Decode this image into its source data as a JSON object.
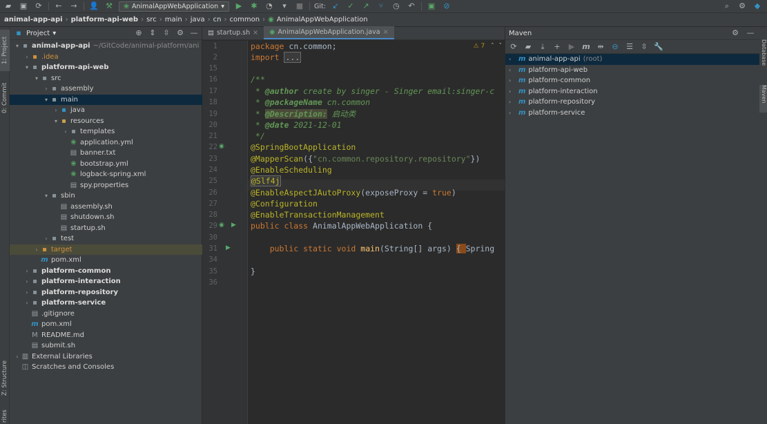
{
  "toolbar": {
    "run_config": "AnimalAppWebApplication",
    "git_label": "Git:"
  },
  "breadcrumb": [
    "animal-app-api",
    "platform-api-web",
    "src",
    "main",
    "java",
    "cn",
    "common",
    "AnimalAppWebApplication"
  ],
  "left_strip": {
    "project_tab": "1: Project",
    "commit_tab": "0: Commit",
    "structure_tab": "Z: Structure",
    "favorites_tab": "rites"
  },
  "project": {
    "title": "Project",
    "tree": [
      {
        "indent": 0,
        "arrow": "▾",
        "icon": "folder",
        "label": "animal-app-api",
        "extra": "~/GitCode/animal-platform/ani",
        "style": "bold"
      },
      {
        "indent": 1,
        "arrow": "›",
        "icon": "folder-idea",
        "label": ".idea",
        "style": "orange"
      },
      {
        "indent": 1,
        "arrow": "▾",
        "icon": "folder",
        "label": "platform-api-web",
        "style": "bold"
      },
      {
        "indent": 2,
        "arrow": "▾",
        "icon": "folder",
        "label": "src"
      },
      {
        "indent": 3,
        "arrow": "›",
        "icon": "folder",
        "label": "assembly"
      },
      {
        "indent": 3,
        "arrow": "▾",
        "icon": "folder",
        "label": "main",
        "selected": true
      },
      {
        "indent": 4,
        "arrow": "›",
        "icon": "folder-src",
        "label": "java"
      },
      {
        "indent": 4,
        "arrow": "▾",
        "icon": "folder-res",
        "label": "resources"
      },
      {
        "indent": 5,
        "arrow": "›",
        "icon": "folder",
        "label": "templates"
      },
      {
        "indent": 5,
        "arrow": "",
        "icon": "spring-file",
        "label": "application.yml"
      },
      {
        "indent": 5,
        "arrow": "",
        "icon": "text-file",
        "label": "banner.txt"
      },
      {
        "indent": 5,
        "arrow": "",
        "icon": "spring-file",
        "label": "bootstrap.yml"
      },
      {
        "indent": 5,
        "arrow": "",
        "icon": "xml-file",
        "label": "logback-spring.xml"
      },
      {
        "indent": 5,
        "arrow": "",
        "icon": "props-file",
        "label": "spy.properties"
      },
      {
        "indent": 3,
        "arrow": "▾",
        "icon": "folder",
        "label": "sbin"
      },
      {
        "indent": 4,
        "arrow": "",
        "icon": "sh-file",
        "label": "assembly.sh"
      },
      {
        "indent": 4,
        "arrow": "",
        "icon": "sh-file",
        "label": "shutdown.sh"
      },
      {
        "indent": 4,
        "arrow": "",
        "icon": "sh-file",
        "label": "startup.sh"
      },
      {
        "indent": 3,
        "arrow": "›",
        "icon": "folder",
        "label": "test"
      },
      {
        "indent": 2,
        "arrow": "›",
        "icon": "folder-target",
        "label": "target",
        "style": "orange",
        "highlight": true
      },
      {
        "indent": 2,
        "arrow": "",
        "icon": "maven-file",
        "label": "pom.xml"
      },
      {
        "indent": 1,
        "arrow": "›",
        "icon": "folder",
        "label": "platform-common",
        "style": "bold"
      },
      {
        "indent": 1,
        "arrow": "›",
        "icon": "folder",
        "label": "platform-interaction",
        "style": "bold"
      },
      {
        "indent": 1,
        "arrow": "›",
        "icon": "folder",
        "label": "platform-repository",
        "style": "bold"
      },
      {
        "indent": 1,
        "arrow": "›",
        "icon": "folder",
        "label": "platform-service",
        "style": "bold"
      },
      {
        "indent": 1,
        "arrow": "",
        "icon": "git-file",
        "label": ".gitignore"
      },
      {
        "indent": 1,
        "arrow": "",
        "icon": "maven-file",
        "label": "pom.xml"
      },
      {
        "indent": 1,
        "arrow": "",
        "icon": "md-file",
        "label": "README.md"
      },
      {
        "indent": 1,
        "arrow": "",
        "icon": "sh-file",
        "label": "submit.sh"
      },
      {
        "indent": 0,
        "arrow": "›",
        "icon": "library",
        "label": "External Libraries"
      },
      {
        "indent": 0,
        "arrow": "",
        "icon": "scratch",
        "label": "Scratches and Consoles"
      }
    ]
  },
  "editor": {
    "tabs": [
      {
        "label": "startup.sh",
        "active": false
      },
      {
        "label": "AnimalAppWebApplication.java",
        "active": true
      }
    ],
    "warning_count": "⚠ 7",
    "line_numbers": [
      "1",
      "2",
      "15",
      "16",
      "17",
      "18",
      "19",
      "20",
      "21",
      "22",
      "23",
      "24",
      "25",
      "26",
      "27",
      "28",
      "29",
      "30",
      "31",
      "34",
      "35",
      "36"
    ]
  },
  "maven": {
    "title": "Maven",
    "projects": [
      {
        "label": "animal-app-api",
        "suffix": "(root)",
        "selected": true
      },
      {
        "label": "platform-api-web"
      },
      {
        "label": "platform-common"
      },
      {
        "label": "platform-interaction"
      },
      {
        "label": "platform-repository"
      },
      {
        "label": "platform-service"
      }
    ]
  },
  "right_strip": {
    "database_tab": "Database",
    "maven_tab": "Maven"
  }
}
